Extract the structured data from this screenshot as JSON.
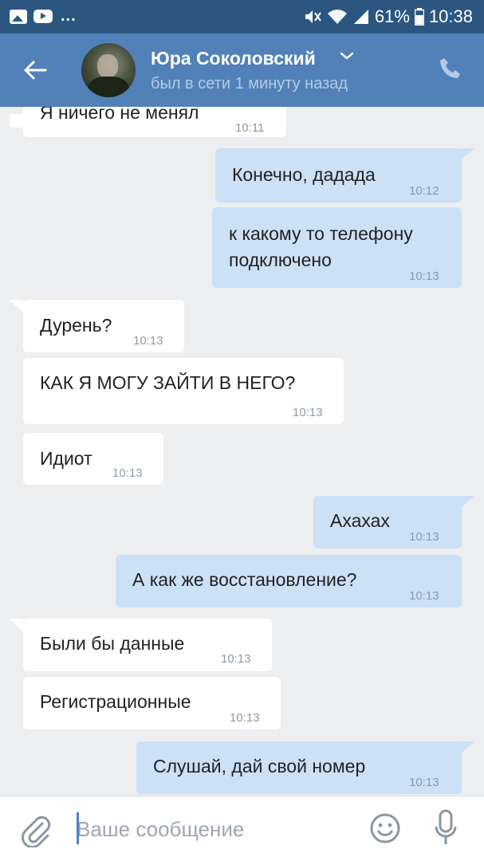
{
  "status_bar": {
    "left_icons": [
      "gallery-icon",
      "chat-icon",
      "youtube-icon"
    ],
    "more": "...",
    "battery_percent": "61%",
    "time": "10:38"
  },
  "header": {
    "contact_name": "Юра Соколовский",
    "contact_status": "был в сети 1 минуту назад"
  },
  "messages": [
    {
      "dir": "in",
      "text": "Я ничего не менял",
      "time": "10:11"
    },
    {
      "dir": "out",
      "text": "Конечно, дадада",
      "time": "10:12"
    },
    {
      "dir": "out",
      "text": "к какому то телефону\nподключено",
      "time": "10:13"
    },
    {
      "dir": "in",
      "text": "Дурень?",
      "time": "10:13"
    },
    {
      "dir": "in",
      "text": "КАК Я МОГУ ЗАЙТИ В НЕГО?",
      "time": "10:13"
    },
    {
      "dir": "in",
      "text": "Идиот",
      "time": "10:13"
    },
    {
      "dir": "out",
      "text": "Ахахах",
      "time": "10:13"
    },
    {
      "dir": "out",
      "text": "А как же восстановление?",
      "time": "10:13"
    },
    {
      "dir": "in",
      "text": "Были бы данные",
      "time": "10:13"
    },
    {
      "dir": "in",
      "text": "Регистрационные",
      "time": "10:13"
    },
    {
      "dir": "out",
      "text": "Слушай, дай свой номер",
      "time": "10:13"
    }
  ],
  "composer": {
    "placeholder": "Ваше сообщение"
  },
  "colors": {
    "status_bar": "#2b5680",
    "header": "#5181b8",
    "background": "#edeef0",
    "incoming_bubble": "#ffffff",
    "outgoing_bubble": "#cce0f6"
  }
}
